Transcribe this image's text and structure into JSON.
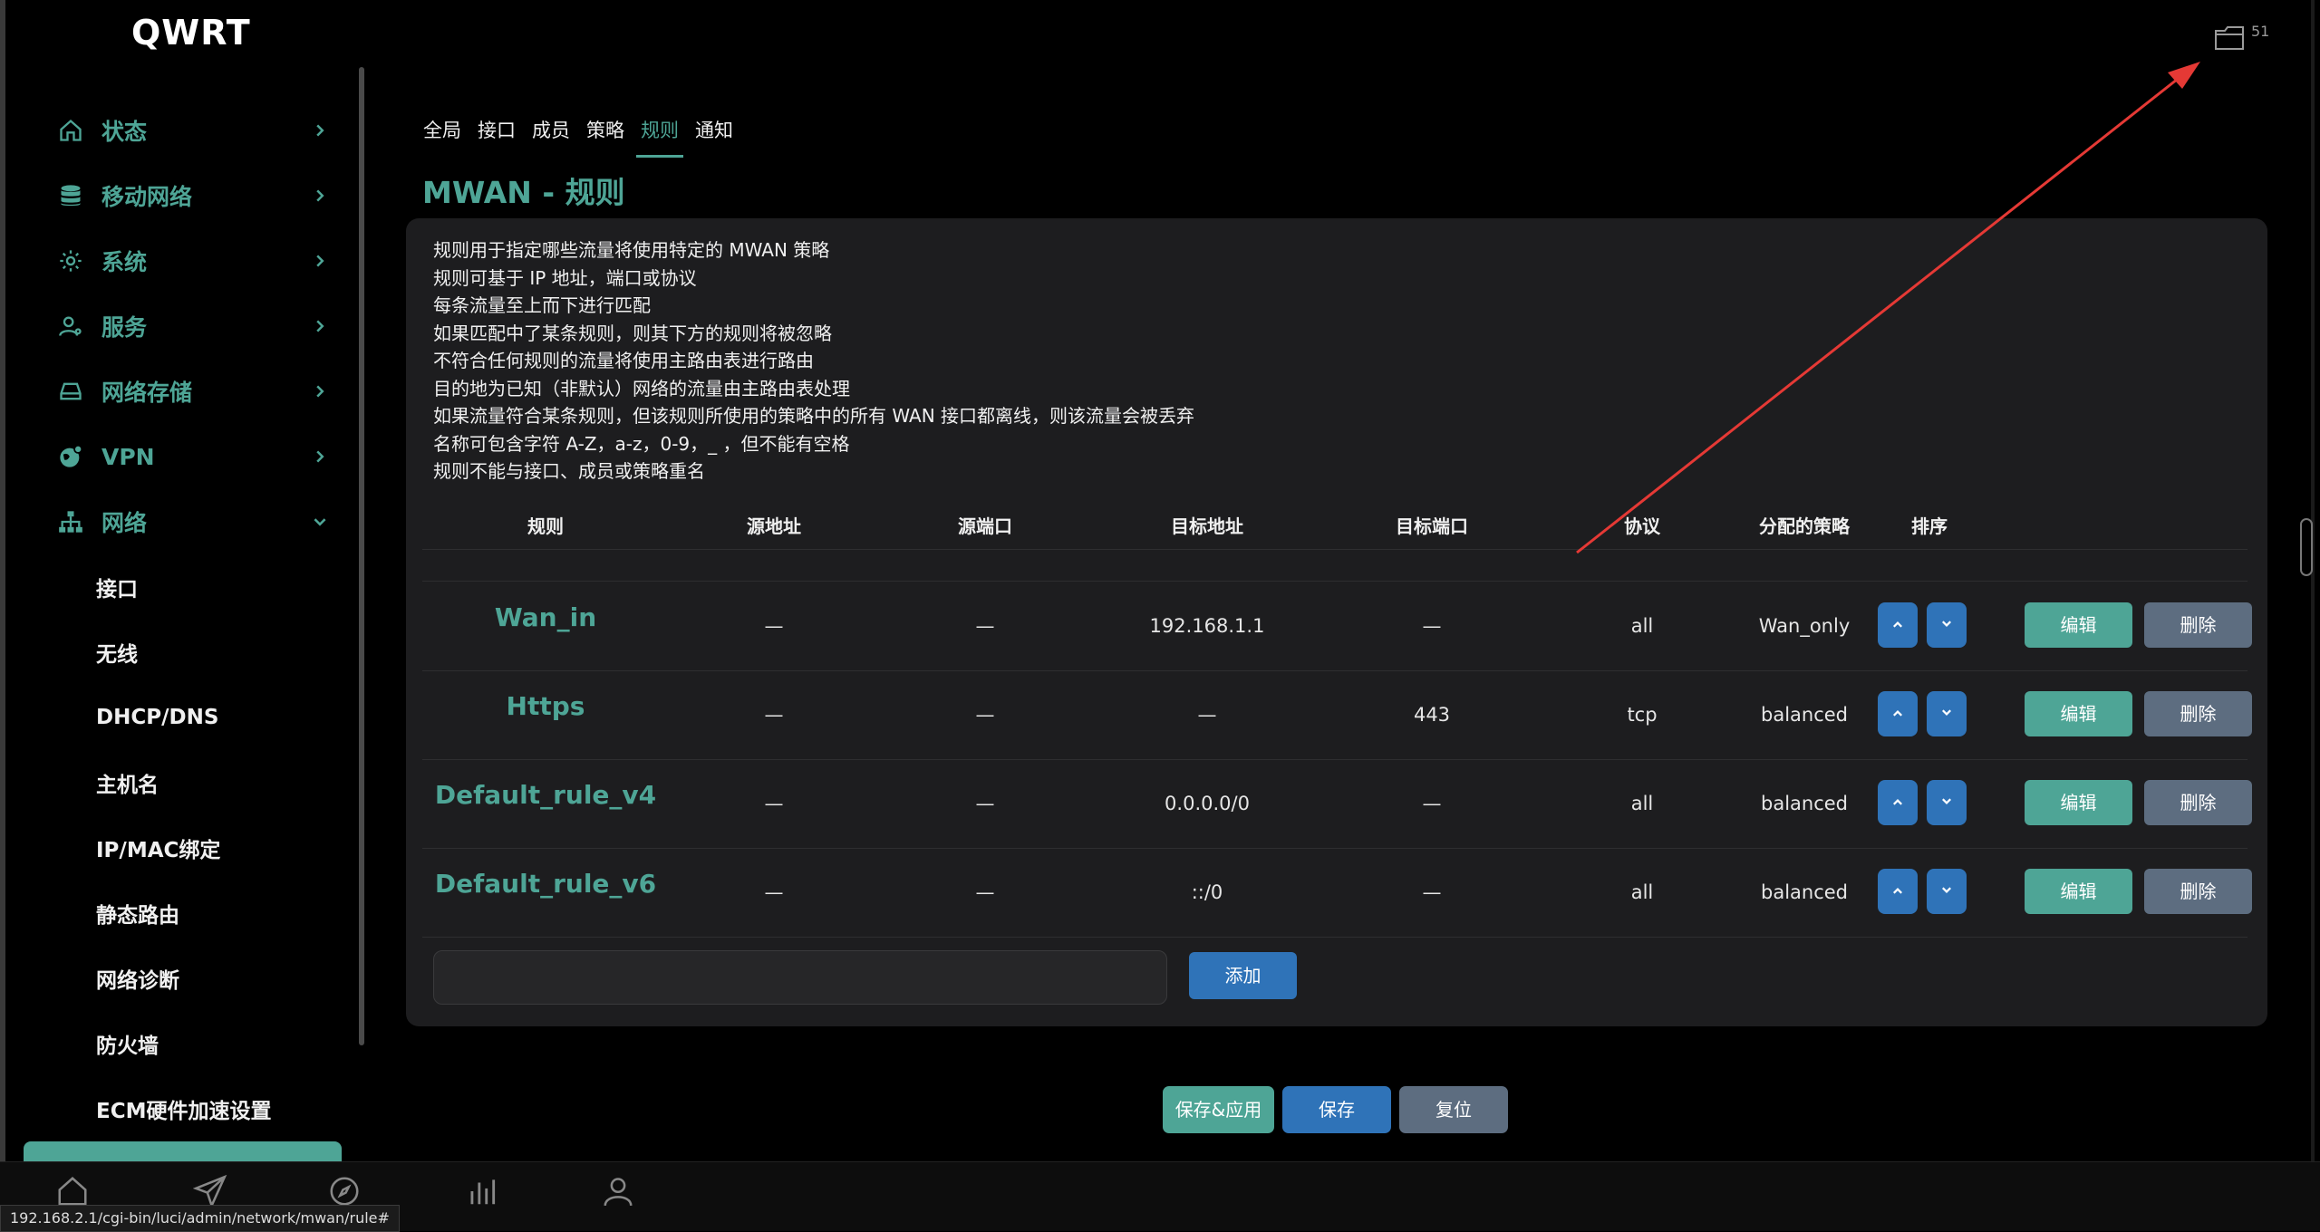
{
  "brand": "QWRT",
  "sidebar": {
    "items": [
      {
        "label": "状态",
        "icon": "home-icon"
      },
      {
        "label": "移动网络",
        "icon": "database-icon"
      },
      {
        "label": "系统",
        "icon": "gear-icon"
      },
      {
        "label": "服务",
        "icon": "user-gear-icon"
      },
      {
        "label": "网络存储",
        "icon": "drive-icon"
      },
      {
        "label": "VPN",
        "icon": "globe-icon"
      },
      {
        "label": "网络",
        "icon": "sitemap-icon"
      }
    ],
    "subitems": [
      "接口",
      "无线",
      "DHCP/DNS",
      "主机名",
      "IP/MAC绑定",
      "静态路由",
      "网络诊断",
      "防火墙",
      "ECM硬件加速设置"
    ]
  },
  "tabs": [
    "全局",
    "接口",
    "成员",
    "策略",
    "规则",
    "通知"
  ],
  "active_tab": "规则",
  "page_title": "MWAN - 规则",
  "description": [
    "规则用于指定哪些流量将使用特定的 MWAN 策略",
    "规则可基于 IP 地址，端口或协议",
    "每条流量至上而下进行匹配",
    "如果匹配中了某条规则，则其下方的规则将被忽略",
    "不符合任何规则的流量将使用主路由表进行路由",
    "目的地为已知（非默认）网络的流量由主路由表处理",
    "如果流量符合某条规则，但该规则所使用的策略中的所有 WAN 接口都离线，则该流量会被丢弃",
    "名称可包含字符 A-Z，a-z，0-9，_ ，但不能有空格",
    "规则不能与接口、成员或策略重名"
  ],
  "table": {
    "headers": [
      "规则",
      "源地址",
      "源端口",
      "目标地址",
      "目标端口",
      "协议",
      "分配的策略",
      "排序"
    ],
    "rows": [
      {
        "name": "Wan_in",
        "src": "—",
        "sport": "—",
        "dest": "192.168.1.1",
        "dport": "—",
        "proto": "all",
        "policy": "Wan_only"
      },
      {
        "name": "Https",
        "src": "—",
        "sport": "—",
        "dest": "—",
        "dport": "443",
        "proto": "tcp",
        "policy": "balanced"
      },
      {
        "name": "Default_rule_v4",
        "src": "—",
        "sport": "—",
        "dest": "0.0.0.0/0",
        "dport": "—",
        "proto": "all",
        "policy": "balanced"
      },
      {
        "name": "Default_rule_v6",
        "src": "—",
        "sport": "—",
        "dest": "::/0",
        "dport": "—",
        "proto": "all",
        "policy": "balanced"
      }
    ],
    "edit_label": "编辑",
    "delete_label": "删除"
  },
  "add": {
    "value": "",
    "button": "添加"
  },
  "actions": {
    "save_apply": "保存&应用",
    "save": "保存",
    "reset": "复位"
  },
  "counter": "51",
  "status_url": "192.168.2.1/cgi-bin/luci/admin/network/mwan/rule#",
  "colors": {
    "accent": "#4ea596",
    "primary": "#2f73b8",
    "secondary": "#5d6d80",
    "annotation": "#e53935"
  }
}
